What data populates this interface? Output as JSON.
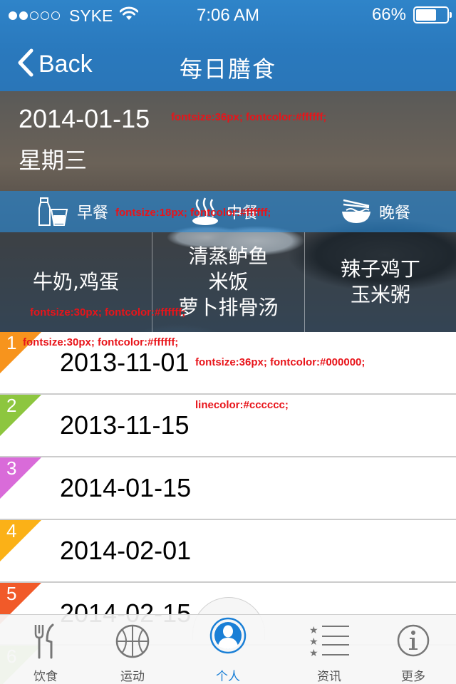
{
  "status_bar": {
    "carrier": "SYKE",
    "time": "7:06 AM",
    "battery_text": "66%",
    "battery_level": 0.66,
    "signal_bars_on": 2,
    "signal_bars_total": 5
  },
  "nav": {
    "back_label": "Back",
    "title": "每日膳食"
  },
  "hero": {
    "date": "2014-01-15",
    "weekday": "星期三",
    "meal_tabs": [
      {
        "label": "早餐",
        "icon": "milk-bottle-icon"
      },
      {
        "label": "中餐",
        "icon": "steaming-dish-icon"
      },
      {
        "label": "晚餐",
        "icon": "noodle-bowl-icon"
      }
    ],
    "meals": {
      "breakfast": [
        "牛奶,鸡蛋"
      ],
      "lunch": [
        "清蒸鲈鱼",
        "米饭",
        "萝卜排骨汤"
      ],
      "dinner": [
        "辣子鸡丁",
        "玉米粥"
      ]
    }
  },
  "annotations": [
    "fontsize:36px; fontcolor:#ffffff;",
    "fontsize:18px; fontcolor:#ffffff;",
    "fontsize:30px; fontcolor:#ffffff;",
    "fontsize:30px; fontcolor:#ffffff;",
    "fontsize:36px; fontcolor:#000000;",
    "linecolor:#cccccc;"
  ],
  "list": [
    {
      "num": "1",
      "date": "2013-11-01",
      "color": "#f7941d"
    },
    {
      "num": "2",
      "date": "2013-11-15",
      "color": "#8dc63f"
    },
    {
      "num": "3",
      "date": "2014-01-15",
      "color": "#d96bd9"
    },
    {
      "num": "4",
      "date": "2014-02-01",
      "color": "#fbb117"
    },
    {
      "num": "5",
      "date": "2014-02-15",
      "color": "#f15a29"
    },
    {
      "num": "6",
      "date": "",
      "color": "#9ed36a"
    }
  ],
  "tab_bar": {
    "tabs": [
      {
        "label": "饮食",
        "icon": "fork-knife-icon"
      },
      {
        "label": "运动",
        "icon": "basketball-icon"
      },
      {
        "label": "个人",
        "icon": "person-icon",
        "active": true
      },
      {
        "label": "资讯",
        "icon": "star-list-icon"
      },
      {
        "label": "更多",
        "icon": "info-icon"
      }
    ]
  },
  "colors": {
    "nav_blue": "#2a79bd",
    "active_tab": "#1a7fd6",
    "line": "#cccccc"
  }
}
